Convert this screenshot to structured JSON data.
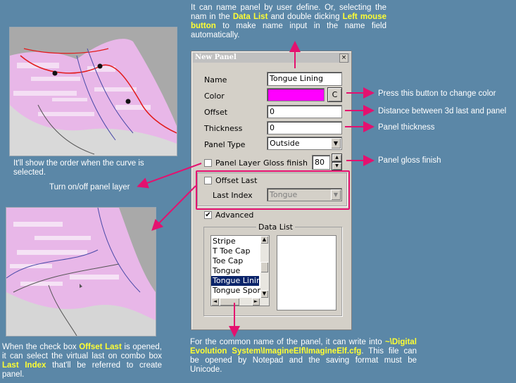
{
  "top_note": {
    "p1": "It can name panel by user define. Or, selecting the nam in the ",
    "hl1": "Data List",
    "p2": " and double dicking ",
    "hl2": "Left mouse button",
    "p3": " to make name input in the name field automatically."
  },
  "dialog": {
    "title": "New Panel",
    "close": "×",
    "name_label": "Name",
    "name_value": "Tongue Lining",
    "color_label": "Color",
    "color_value": "#ff00ff",
    "color_button": "C",
    "offset_label": "Offset",
    "offset_value": "0",
    "thickness_label": "Thickness",
    "thickness_value": "0",
    "panel_type_label": "Panel Type",
    "panel_type_value": "Outside",
    "panel_layer_label": "Panel Layer",
    "gloss_label": "Gloss finish",
    "gloss_value": "80",
    "offset_last_label": "Offset Last",
    "last_index_label": "Last Index",
    "last_index_value": "Tongue",
    "advanced_label": "Advanced",
    "advanced_checked": "✔",
    "data_list_label": "Data List",
    "data_list": [
      "Stripe",
      "T Toe Cap",
      "Toe Cap",
      "Tongue",
      "Tongue Linin",
      "Tongue Spor"
    ],
    "selected_index": 4
  },
  "right_notes": {
    "color_btn": "Press this button to change color",
    "offset": "Distance between 3d last and panel",
    "thickness": "Panel thickness",
    "gloss": "Panel gloss finish"
  },
  "left_notes": {
    "curve_order": "It'll show the order when the curve is selected.",
    "panel_layer": "Turn on/off panel layer",
    "offset_last": {
      "p1": "When the check box ",
      "hl1": "Offset Last",
      "p2": " is opened, it can select the virtual last on combo box ",
      "hl2": "Last Index",
      "p3": " that'll be referred to create panel."
    }
  },
  "bottom_note": {
    "p1": "For the common name of the panel, it can write into ",
    "hl1": "~\\Digital Evolution System\\ImagineElf\\ImagineElf.cfg",
    "p2": ". This file can be opened by Notepad and the saving format must be Unicode."
  },
  "colors": {
    "background": "#5b87a7",
    "highlight": "#ffff33",
    "arrow": "#e4116f",
    "selection": "#0a246a"
  }
}
